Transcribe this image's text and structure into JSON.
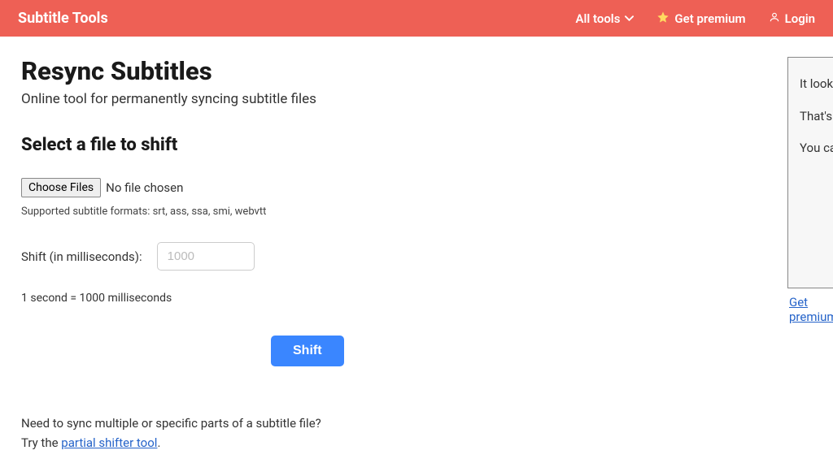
{
  "header": {
    "brand": "Subtitle Tools",
    "nav": {
      "all_tools": "All tools",
      "get_premium": "Get premium",
      "login": "Login"
    }
  },
  "main": {
    "title": "Resync Subtitles",
    "subtitle": "Online tool for permanently syncing subtitle files",
    "section_title": "Select a file to shift",
    "choose_files_label": "Choose Files",
    "no_file_chosen": "No file chosen",
    "supported_formats": "Supported subtitle formats: srt, ass, ssa, smi, webvtt",
    "shift_label": "Shift (in milliseconds):",
    "shift_placeholder": "1000",
    "conversion_hint": "1 second = 1000 milliseconds",
    "submit_label": "Shift",
    "footer_line1": "Need to sync multiple or specific parts of a subtitle file?",
    "footer_line2_prefix": "Try the ",
    "footer_link_text": "partial shifter tool",
    "footer_line2_suffix": "."
  },
  "sidebar": {
    "line1": "It looks like you're using an ad blocker.",
    "line2": "That's okay.",
    "line3": "You can support us by getting premium.",
    "get_premium_link": "Get premium"
  }
}
